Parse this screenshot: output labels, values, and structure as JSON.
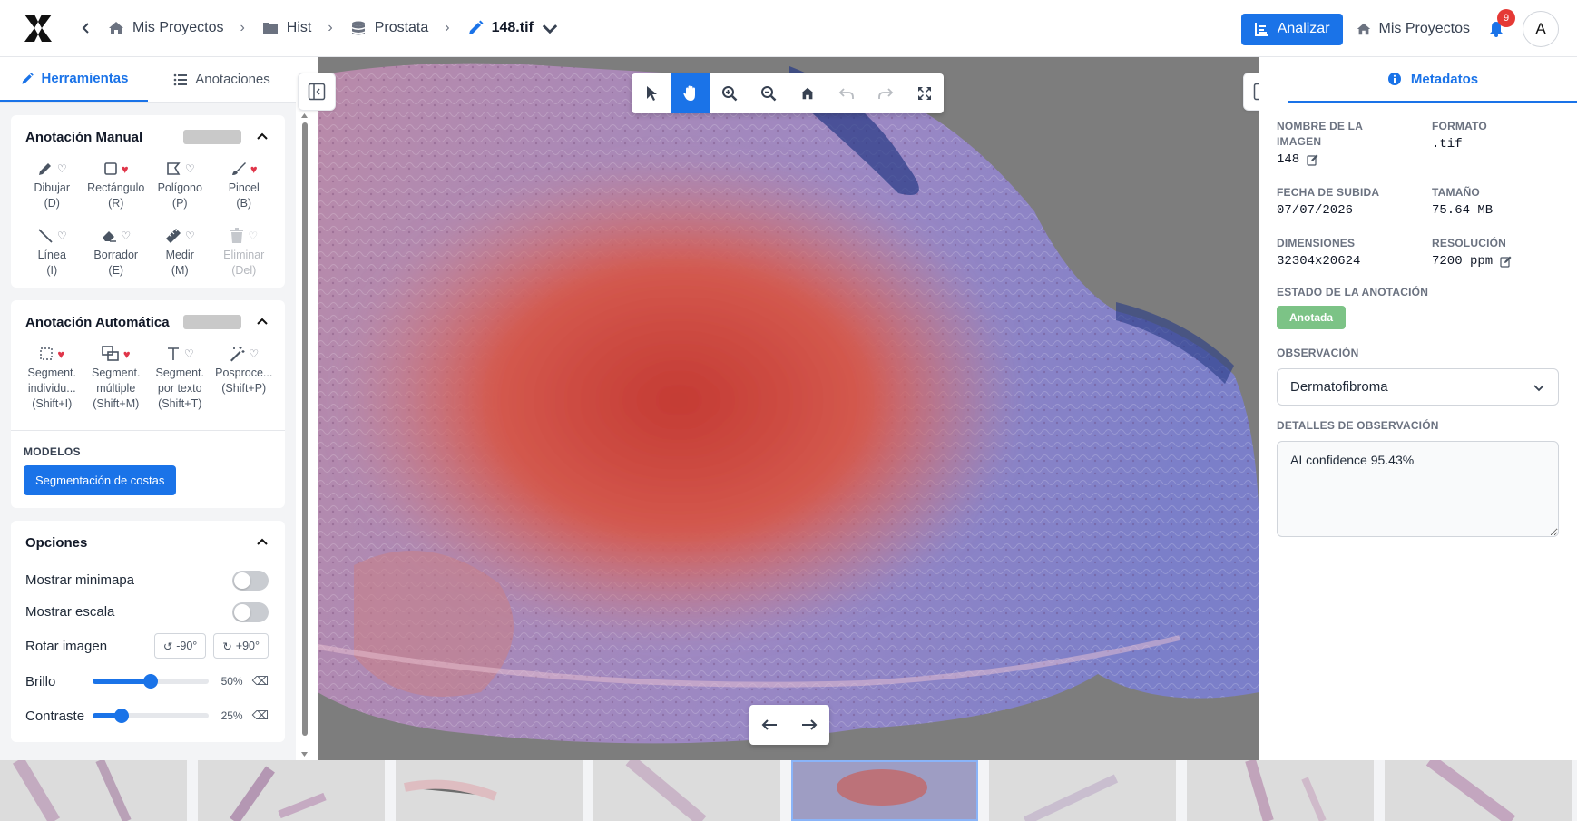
{
  "header": {
    "breadcrumbs": [
      {
        "label": "Mis Proyectos",
        "icon": "home-icon"
      },
      {
        "label": "Hist",
        "icon": "folder-icon"
      },
      {
        "label": "Prostata",
        "icon": "database-icon"
      },
      {
        "label": "148.tif",
        "icon": "pencil-icon"
      }
    ],
    "analyze_label": "Analizar",
    "projects_label": "Mis Proyectos",
    "notification_count": "9",
    "avatar_initial": "A"
  },
  "sidebar": {
    "tabs": [
      {
        "label": "Herramientas",
        "icon": "pencil-icon",
        "active": true
      },
      {
        "label": "Anotaciones",
        "icon": "list-icon",
        "active": false
      }
    ],
    "manual": {
      "title": "Anotación Manual",
      "tools": [
        {
          "label": "Dibujar",
          "key": "(D)",
          "icon": "pen-icon",
          "fav": false
        },
        {
          "label": "Rectángulo",
          "key": "(R)",
          "icon": "square-icon",
          "fav": true
        },
        {
          "label": "Polígono",
          "key": "(P)",
          "icon": "polygon-icon",
          "fav": false
        },
        {
          "label": "Pincel",
          "key": "(B)",
          "icon": "brush-icon",
          "fav": true
        },
        {
          "label": "Línea",
          "key": "(I)",
          "icon": "line-icon",
          "fav": false
        },
        {
          "label": "Borrador",
          "key": "(E)",
          "icon": "eraser-icon",
          "fav": false
        },
        {
          "label": "Medir",
          "key": "(M)",
          "icon": "ruler-icon",
          "fav": false
        },
        {
          "label": "Eliminar",
          "key": "(Del)",
          "icon": "trash-icon",
          "fav": false,
          "disabled": true
        }
      ]
    },
    "auto": {
      "title": "Anotación Automática",
      "tools": [
        {
          "label": "Segment.",
          "label2": "individu...",
          "key": "(Shift+I)",
          "icon": "dotted-square-icon",
          "fav": true
        },
        {
          "label": "Segment.",
          "label2": "múltiple",
          "key": "(Shift+M)",
          "icon": "multi-select-icon",
          "fav": true
        },
        {
          "label": "Segment.",
          "label2": "por texto",
          "key": "(Shift+T)",
          "icon": "text-icon",
          "fav": false
        },
        {
          "label": "Posproce...",
          "label2": "",
          "key": "(Shift+P)",
          "icon": "magic-wand-icon",
          "fav": false
        }
      ],
      "models_label": "MODELOS",
      "model_button": "Segmentación de costas"
    },
    "options": {
      "title": "Opciones",
      "minimap_label": "Mostrar minimapa",
      "scale_label": "Mostrar escala",
      "rotate_label": "Rotar imagen",
      "rotate_left": "-90°",
      "rotate_right": "+90°",
      "brightness_label": "Brillo",
      "brightness_value": 50,
      "brightness_text": "50%",
      "contrast_label": "Contraste",
      "contrast_value": 25,
      "contrast_text": "25%"
    }
  },
  "metadata": {
    "tab_label": "Metadatos",
    "name_label": "NOMBRE DE LA IMAGEN",
    "name_value": "148",
    "format_label": "FORMATO",
    "format_value": ".tif",
    "upload_label": "FECHA DE SUBIDA",
    "upload_value": "07/07/2026",
    "size_label": "TAMAÑO",
    "size_value": "75.64 MB",
    "dims_label": "DIMENSIONES",
    "dims_value": "32304x20624",
    "res_label": "RESOLUCIÓN",
    "res_value": "7200 ppm",
    "status_label": "ESTADO DE LA ANOTACIÓN",
    "status_value": "Anotada",
    "obs_label": "OBSERVACIÓN",
    "obs_value": "Dermatofibroma",
    "details_label": "DETALLES DE OBSERVACIÓN",
    "details_value": "AI confidence 95.43%"
  },
  "colors": {
    "accent": "#1a73e8",
    "status_green": "#7cc386",
    "favorite_red": "#e0364a"
  }
}
